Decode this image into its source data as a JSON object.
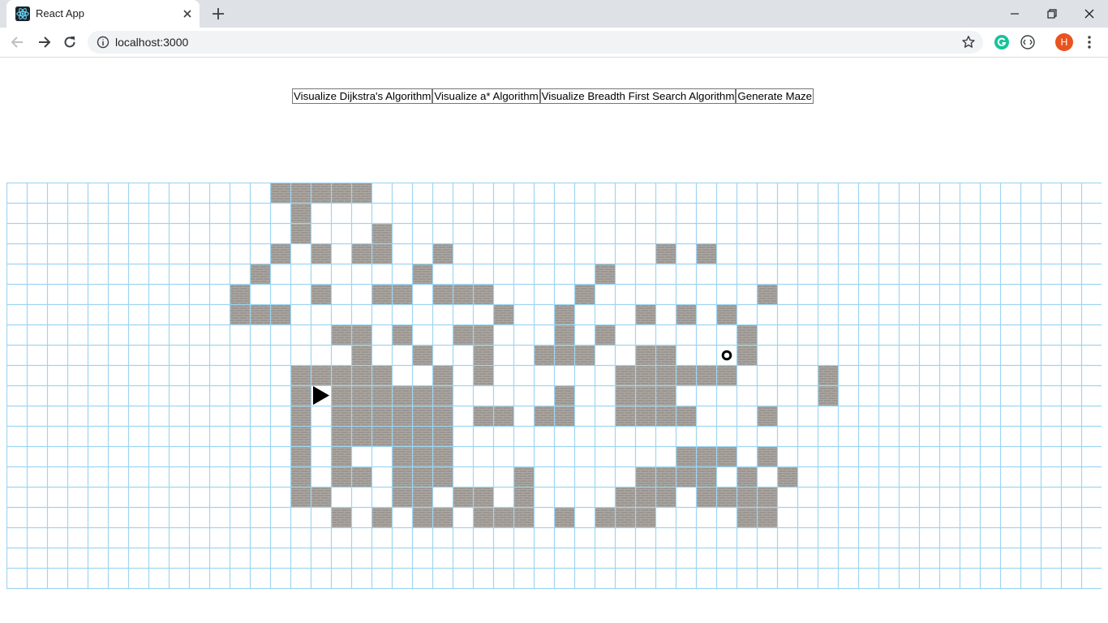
{
  "browser": {
    "tab_title": "React App",
    "url": "localhost:3000",
    "profile_initial": "H",
    "icons": {
      "favicon": "react-logo-icon",
      "close": "close-icon",
      "new_tab": "plus-icon",
      "back": "back-arrow-icon",
      "forward": "forward-arrow-icon",
      "reload": "reload-icon",
      "site_info": "info-icon",
      "bookmark": "star-icon",
      "extension_grammarly": "grammarly-icon",
      "extension_other": "extension-icon",
      "menu": "kebab-menu-icon"
    }
  },
  "toolbar": {
    "buttons": [
      "Visualize Dijkstra's Algorithm",
      "Visualize a* Algorithm",
      "Visualize Breadth First Search Algorithm",
      "Generate Maze"
    ]
  },
  "grid": {
    "cols": 54,
    "rows": 20,
    "line_color": "#9fd5f2",
    "wall_color": "#9a9590",
    "walls": [
      [
        0,
        13
      ],
      [
        0,
        14
      ],
      [
        0,
        15
      ],
      [
        0,
        16
      ],
      [
        0,
        17
      ],
      [
        1,
        14
      ],
      [
        2,
        14
      ],
      [
        2,
        18
      ],
      [
        3,
        13
      ],
      [
        3,
        15
      ],
      [
        3,
        17
      ],
      [
        3,
        18
      ],
      [
        3,
        21
      ],
      [
        3,
        32
      ],
      [
        3,
        34
      ],
      [
        4,
        12
      ],
      [
        4,
        20
      ],
      [
        4,
        29
      ],
      [
        5,
        11
      ],
      [
        5,
        15
      ],
      [
        5,
        18
      ],
      [
        5,
        19
      ],
      [
        5,
        21
      ],
      [
        5,
        22
      ],
      [
        5,
        23
      ],
      [
        5,
        28
      ],
      [
        5,
        37
      ],
      [
        6,
        11
      ],
      [
        6,
        12
      ],
      [
        6,
        13
      ],
      [
        6,
        24
      ],
      [
        6,
        27
      ],
      [
        6,
        31
      ],
      [
        6,
        33
      ],
      [
        6,
        35
      ],
      [
        7,
        16
      ],
      [
        7,
        17
      ],
      [
        7,
        19
      ],
      [
        7,
        22
      ],
      [
        7,
        23
      ],
      [
        7,
        27
      ],
      [
        7,
        29
      ],
      [
        7,
        36
      ],
      [
        8,
        17
      ],
      [
        8,
        20
      ],
      [
        8,
        23
      ],
      [
        8,
        26
      ],
      [
        8,
        27
      ],
      [
        8,
        28
      ],
      [
        8,
        31
      ],
      [
        8,
        32
      ],
      [
        8,
        36
      ],
      [
        9,
        14
      ],
      [
        9,
        15
      ],
      [
        9,
        16
      ],
      [
        9,
        17
      ],
      [
        9,
        18
      ],
      [
        9,
        21
      ],
      [
        9,
        23
      ],
      [
        9,
        30
      ],
      [
        9,
        31
      ],
      [
        9,
        32
      ],
      [
        9,
        33
      ],
      [
        9,
        34
      ],
      [
        9,
        35
      ],
      [
        9,
        40
      ],
      [
        10,
        14
      ],
      [
        10,
        16
      ],
      [
        10,
        17
      ],
      [
        10,
        18
      ],
      [
        10,
        19
      ],
      [
        10,
        20
      ],
      [
        10,
        21
      ],
      [
        10,
        27
      ],
      [
        10,
        30
      ],
      [
        10,
        31
      ],
      [
        10,
        32
      ],
      [
        10,
        40
      ],
      [
        11,
        14
      ],
      [
        11,
        16
      ],
      [
        11,
        17
      ],
      [
        11,
        18
      ],
      [
        11,
        19
      ],
      [
        11,
        20
      ],
      [
        11,
        21
      ],
      [
        11,
        23
      ],
      [
        11,
        24
      ],
      [
        11,
        26
      ],
      [
        11,
        27
      ],
      [
        11,
        30
      ],
      [
        11,
        31
      ],
      [
        11,
        32
      ],
      [
        11,
        33
      ],
      [
        11,
        37
      ],
      [
        12,
        14
      ],
      [
        12,
        16
      ],
      [
        12,
        17
      ],
      [
        12,
        18
      ],
      [
        12,
        19
      ],
      [
        12,
        20
      ],
      [
        12,
        21
      ],
      [
        13,
        14
      ],
      [
        13,
        16
      ],
      [
        13,
        19
      ],
      [
        13,
        20
      ],
      [
        13,
        21
      ],
      [
        13,
        33
      ],
      [
        13,
        34
      ],
      [
        13,
        35
      ],
      [
        13,
        37
      ],
      [
        14,
        14
      ],
      [
        14,
        16
      ],
      [
        14,
        17
      ],
      [
        14,
        19
      ],
      [
        14,
        20
      ],
      [
        14,
        21
      ],
      [
        14,
        25
      ],
      [
        14,
        31
      ],
      [
        14,
        32
      ],
      [
        14,
        33
      ],
      [
        14,
        34
      ],
      [
        14,
        36
      ],
      [
        14,
        38
      ],
      [
        15,
        14
      ],
      [
        15,
        15
      ],
      [
        15,
        19
      ],
      [
        15,
        20
      ],
      [
        15,
        22
      ],
      [
        15,
        23
      ],
      [
        15,
        25
      ],
      [
        15,
        30
      ],
      [
        15,
        31
      ],
      [
        15,
        32
      ],
      [
        15,
        34
      ],
      [
        15,
        35
      ],
      [
        15,
        36
      ],
      [
        15,
        37
      ],
      [
        16,
        16
      ],
      [
        16,
        18
      ],
      [
        16,
        20
      ],
      [
        16,
        21
      ],
      [
        16,
        23
      ],
      [
        16,
        24
      ],
      [
        16,
        25
      ],
      [
        16,
        27
      ],
      [
        16,
        29
      ],
      [
        16,
        30
      ],
      [
        16,
        31
      ],
      [
        16,
        36
      ],
      [
        16,
        37
      ]
    ],
    "start": {
      "row": 10,
      "col": 15,
      "icon": "play-triangle-icon"
    },
    "target": {
      "row": 8,
      "col": 35,
      "icon": "target-circle-icon"
    }
  }
}
